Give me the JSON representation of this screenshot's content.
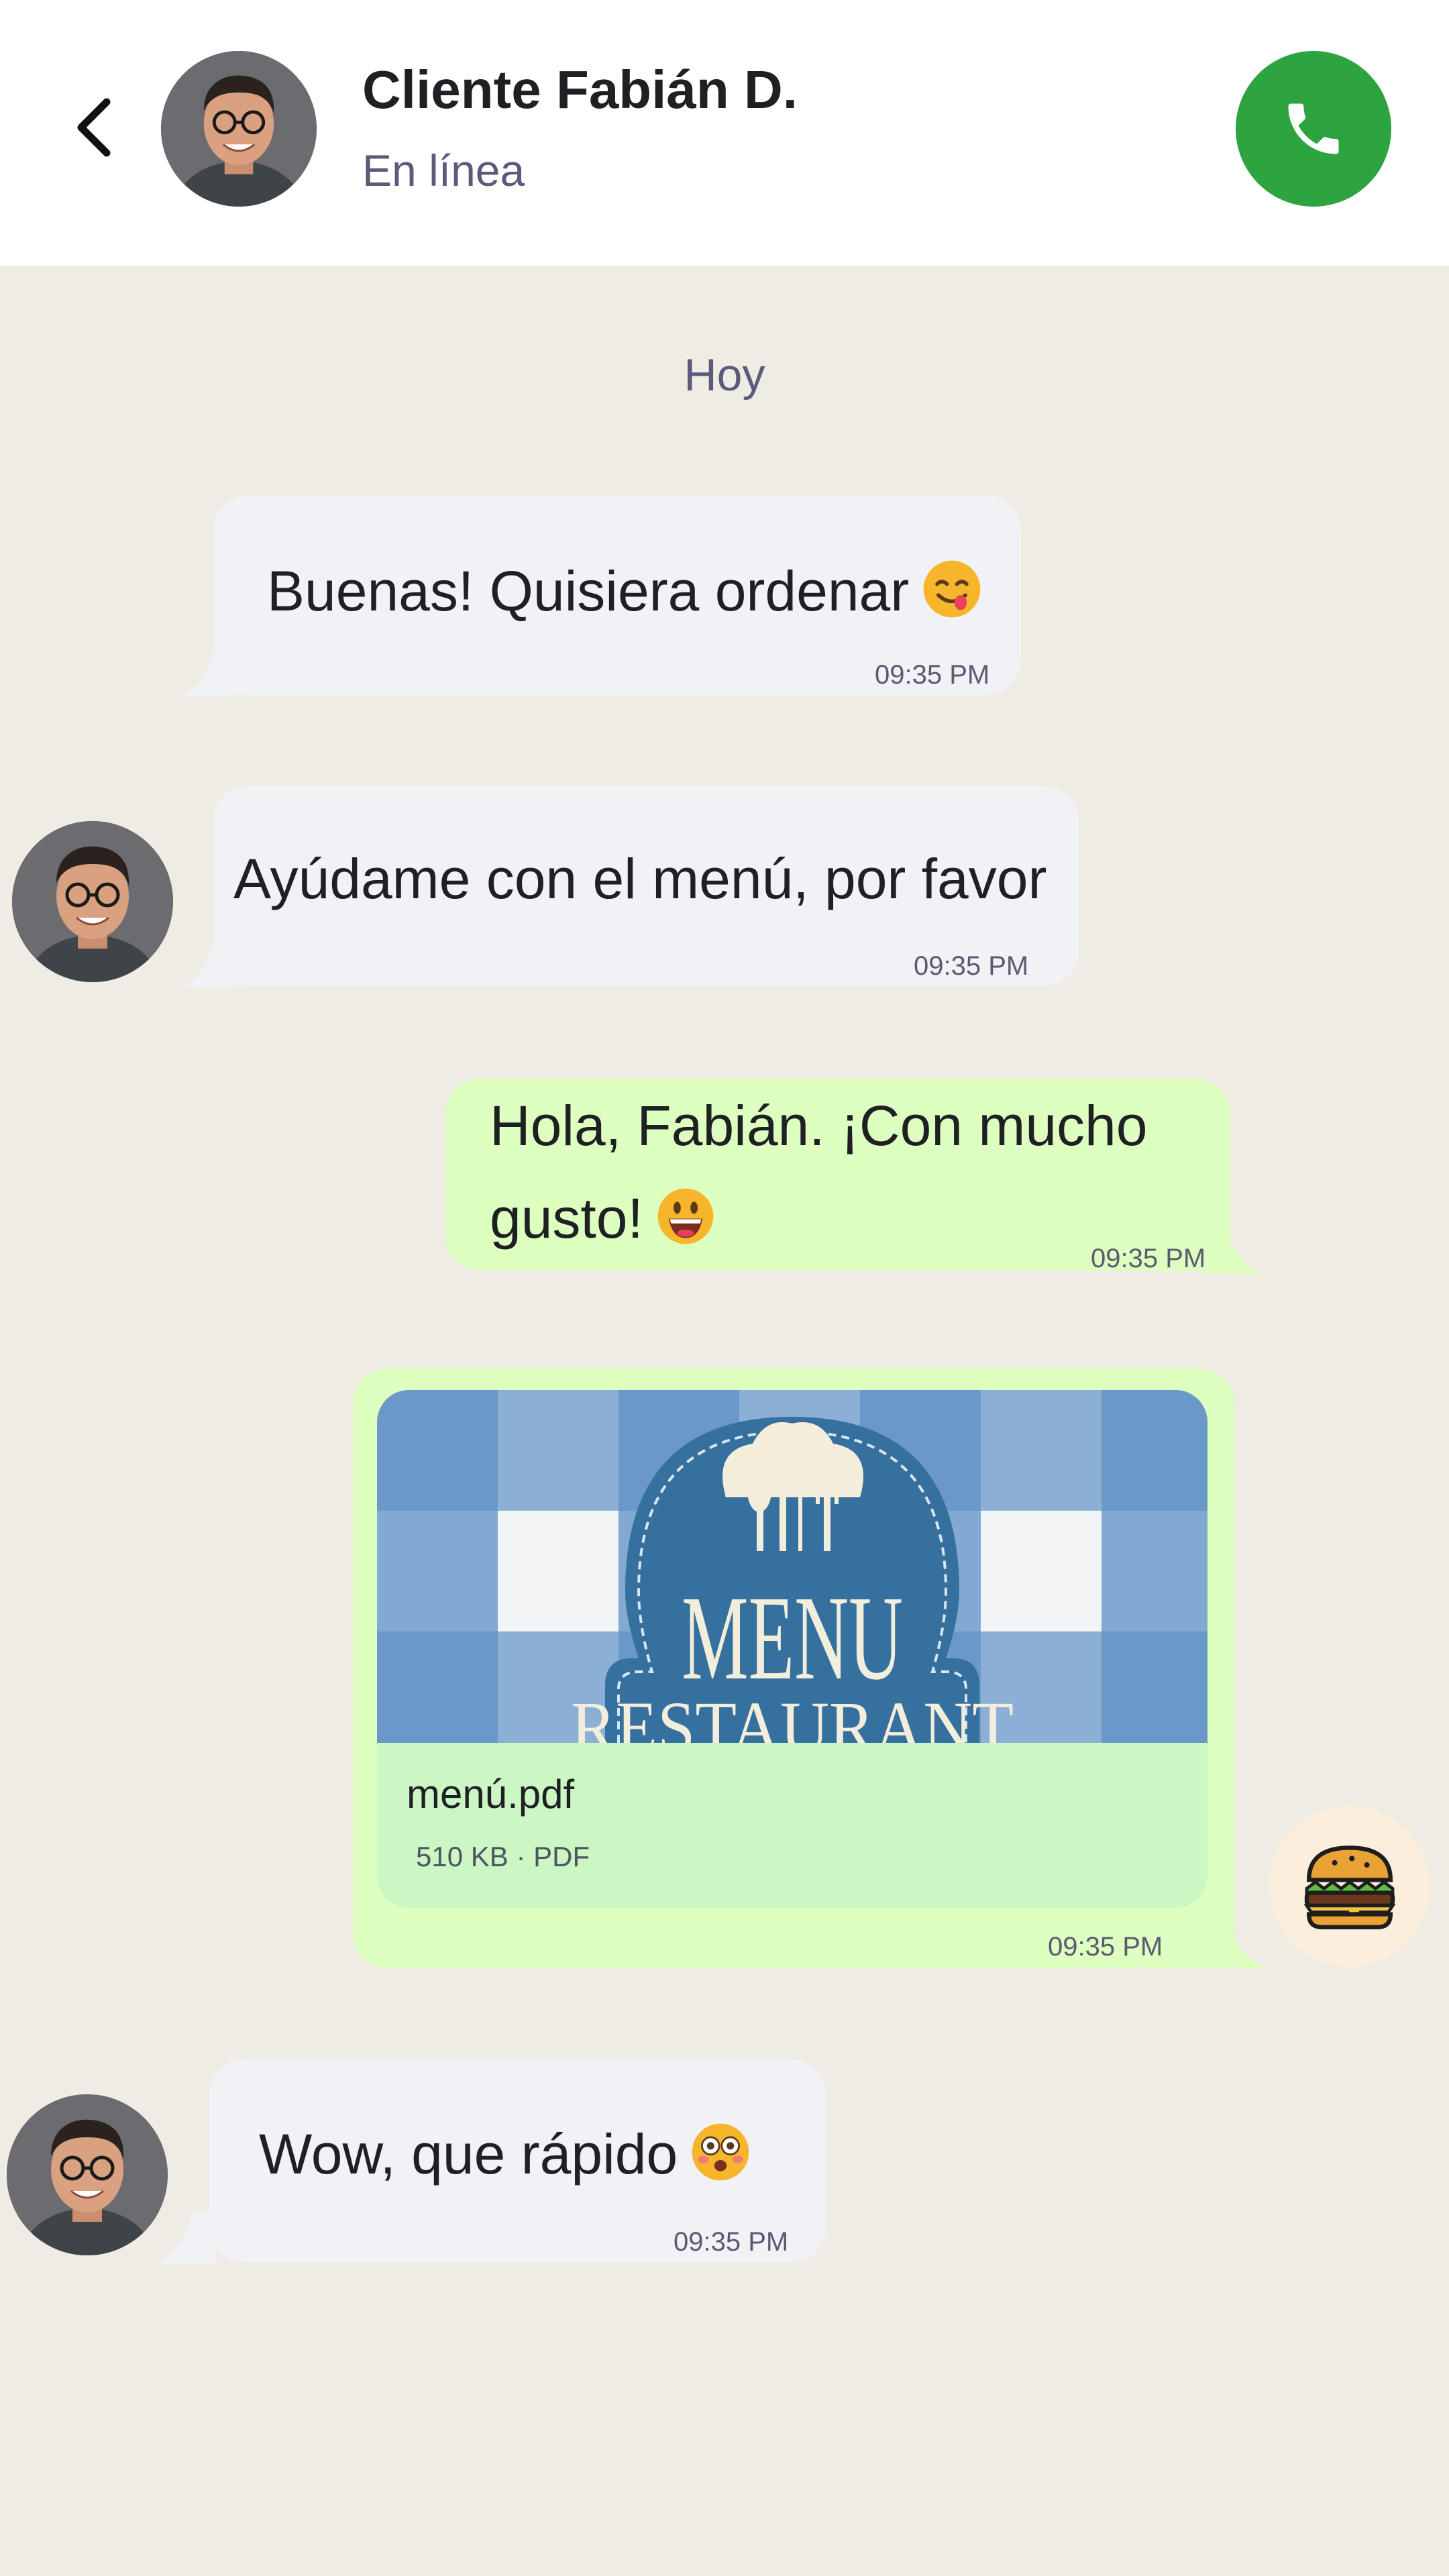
{
  "header": {
    "contact_name": "Cliente Fabián D.",
    "status": "En línea",
    "back_icon": "chevron-left-icon",
    "call_icon": "phone-icon",
    "call_color": "#2EA441"
  },
  "chat": {
    "day_label": "Hoy",
    "messages": [
      {
        "direction": "incoming",
        "text": "Buenas! Quisiera ordenar",
        "emoji": "face-savoring-food",
        "time": "09:35 PM"
      },
      {
        "direction": "incoming",
        "text": "Ayúdame con el menú, por favor",
        "time": "09:35 PM"
      },
      {
        "direction": "outgoing",
        "line1": "Hola, Fabián. ¡Con mucho",
        "line2": "gusto!",
        "emoji": "grinning-face",
        "time": "09:35 PM"
      },
      {
        "direction": "outgoing",
        "attachment": {
          "file_name": "menú.pdf",
          "meta": "510 KB · PDF",
          "thumbnail_text": "MENU",
          "thumbnail_text2": "RESTAURANT"
        },
        "time": "09:35 PM"
      },
      {
        "direction": "incoming",
        "text": "Wow, que rápido",
        "emoji": "flushed-face",
        "time": "09:35 PM"
      }
    ],
    "agent_avatar_icon": "hamburger-icon"
  },
  "colors": {
    "background": "#EEECE3",
    "incoming_bubble": "#F1F2F6",
    "outgoing_bubble": "#DDFFBF"
  }
}
